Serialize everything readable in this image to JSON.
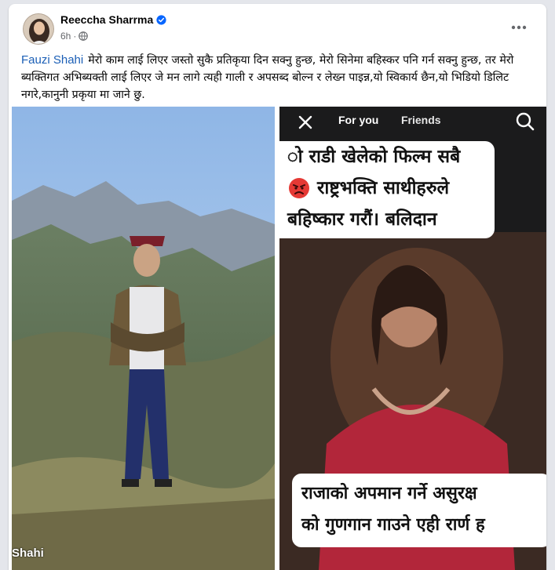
{
  "post": {
    "author": "Reeccha Sharrma",
    "time": "6h",
    "mention": "Fauzi Shahi",
    "caption": "मेरो काम लाई लिएर जस्तो सुकै प्रतिकृया दिन सक्नु हुन्छ, मेरो सिनेमा बहिस्कर पनि गर्न सक्नु हुन्छ, तर मेरो ब्यक्तिगत अभिब्यक्ती लाई लिएर जे मन लागे त्यही गाली र अपसब्द बोल्न र लेख्न पाइन्न,यो स्विकार्य छैन,यो भिडियो डिलिट नगरे,कानुनी प्रकृया मा जाने छु."
  },
  "left_image": {
    "caption_text": "Shahi"
  },
  "right_image": {
    "tab_for_you": "For you",
    "tab_friends": "Friends",
    "top_line1": "ो राडी खेलेको फिल्म सबै",
    "top_line2": "राष्ट्रभक्ति साथीहरुले",
    "top_line3": "बहिष्कार गरौं। बलिदान",
    "bottom_line1": "राजाको अपमान गर्ने असुरक्ष",
    "bottom_line2": "को गुणगान गाउने एही रार्ण ह"
  },
  "colors": {
    "link": "#1b5fb6",
    "verified": "#0866ff",
    "meta": "#65676b"
  },
  "icons": [
    "verified-badge-icon",
    "globe-icon",
    "more-options-icon",
    "close-icon",
    "search-icon",
    "angry-face-emoji"
  ]
}
